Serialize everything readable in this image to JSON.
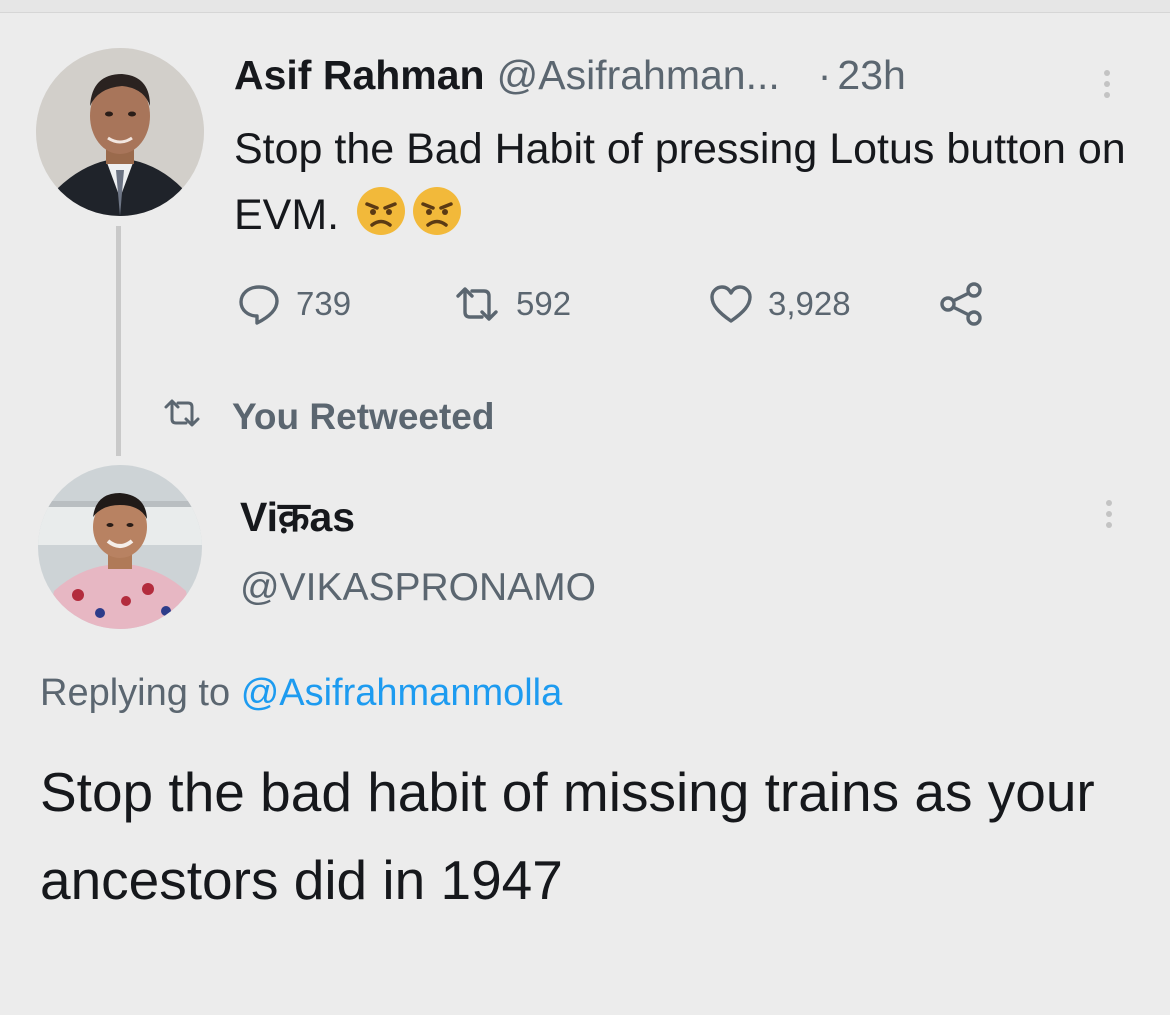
{
  "original_tweet": {
    "author_name": "Asif Rahman",
    "author_handle": "@Asifrahman...",
    "separator": "·",
    "time": "23h",
    "text": "Stop the Bad Habit of pressing Lotus button on EVM.",
    "emojis": [
      "angry-face-emoji",
      "angry-face-emoji"
    ],
    "stats": {
      "replies": "739",
      "retweets": "592",
      "likes": "3,928"
    }
  },
  "retweet_status": {
    "label": "You Retweeted"
  },
  "reply_tweet": {
    "author_name": "Viक़as",
    "author_handle": "@VIKASPRONAMO",
    "replying_prefix": "Replying to",
    "replying_handle": "@Asifrahmanmolla",
    "text": "Stop the bad habit of missing trains as your ancestors did in 1947"
  },
  "colors": {
    "background": "#ececec",
    "text_primary": "#16181c",
    "text_secondary": "#5b6670",
    "link": "#1d9bf0",
    "thread_line": "#c9c9c9"
  },
  "icons": [
    "reply-icon",
    "retweet-icon",
    "like-icon",
    "share-icon",
    "more-icon",
    "retweeted-icon"
  ]
}
